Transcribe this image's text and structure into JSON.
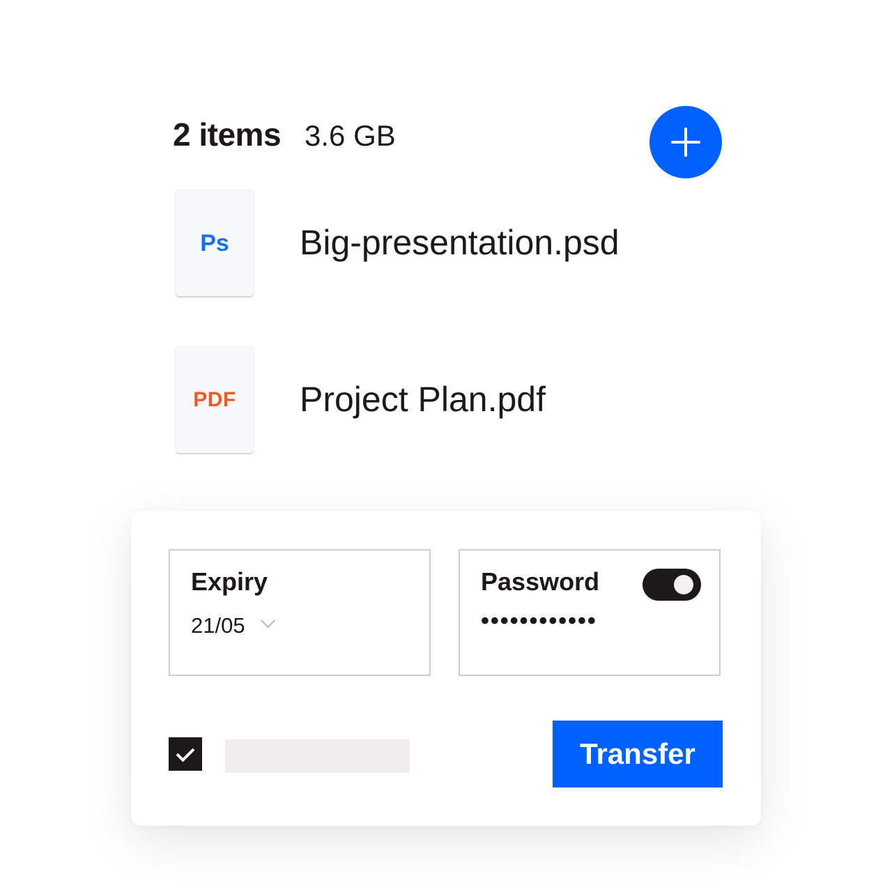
{
  "header": {
    "item_count": "2 items",
    "total_size": "3.6 GB"
  },
  "add_button": {
    "icon": "plus-icon",
    "color": "#0061fe"
  },
  "files": [
    {
      "type_label": "Ps",
      "type_color": "#1473e6",
      "name": "Big-presentation.psd"
    },
    {
      "type_label": "PDF",
      "type_color": "#f15a22",
      "name": "Project Plan.pdf"
    }
  ],
  "options": {
    "expiry": {
      "label": "Expiry",
      "value": "21/05",
      "icon": "chevron-down-icon"
    },
    "password": {
      "label": "Password",
      "value": "••••••••••••",
      "toggle_on": true
    }
  },
  "footer": {
    "checkbox_checked": true,
    "transfer_label": "Transfer",
    "accent_color": "#0061fe"
  }
}
